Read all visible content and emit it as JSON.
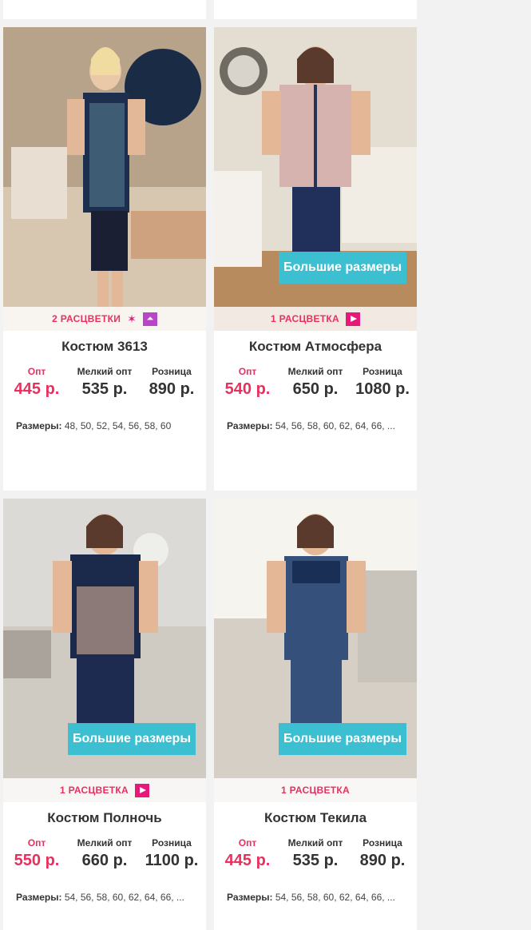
{
  "products": [
    {
      "title": "Костюм 3613",
      "colors_label": "2 РАСЦВЕТКИ",
      "big_sizes_badge": "",
      "icons": [
        "sparkle-icon",
        "hanger-icon"
      ],
      "price_labels": {
        "opt": "Опт",
        "small_opt": "Мелкий опт",
        "retail": "Розница"
      },
      "prices": {
        "opt": "445 р.",
        "small_opt": "535 р.",
        "retail": "890 р."
      },
      "sizes_label": "Размеры:",
      "sizes": "48, 50, 52, 54, 56, 58, 60"
    },
    {
      "title": "Костюм Атмосфера",
      "colors_label": "1 РАСЦВЕТКА",
      "big_sizes_badge": "Большие размеры",
      "icons": [
        "play-icon"
      ],
      "price_labels": {
        "opt": "Опт",
        "small_opt": "Мелкий опт",
        "retail": "Розница"
      },
      "prices": {
        "opt": "540 р.",
        "small_opt": "650 р.",
        "retail": "1080 р."
      },
      "sizes_label": "Размеры:",
      "sizes": "54, 56, 58, 60, 62, 64, 66, ..."
    },
    {
      "title": "Костюм Полночь",
      "colors_label": "1 РАСЦВЕТКА",
      "big_sizes_badge": "Большие размеры",
      "icons": [
        "play-icon"
      ],
      "price_labels": {
        "opt": "Опт",
        "small_opt": "Мелкий опт",
        "retail": "Розница"
      },
      "prices": {
        "opt": "550 р.",
        "small_opt": "660 р.",
        "retail": "1100 р."
      },
      "sizes_label": "Размеры:",
      "sizes": "54, 56, 58, 60, 62, 64, 66, ..."
    },
    {
      "title": "Костюм Текила",
      "colors_label": "1 РАСЦВЕТКА",
      "big_sizes_badge": "Большие размеры",
      "icons": [],
      "price_labels": {
        "opt": "Опт",
        "small_opt": "Мелкий опт",
        "retail": "Розница"
      },
      "prices": {
        "opt": "445 р.",
        "small_opt": "535 р.",
        "retail": "890 р."
      },
      "sizes_label": "Размеры:",
      "sizes": "54, 56, 58, 60, 62, 64, 66, ..."
    }
  ],
  "colors": {
    "accent_pink": "#e8305f",
    "badge_blue": "#3dbfd2",
    "icon_magenta": "#e6197a",
    "icon_purple": "#b845c7"
  }
}
